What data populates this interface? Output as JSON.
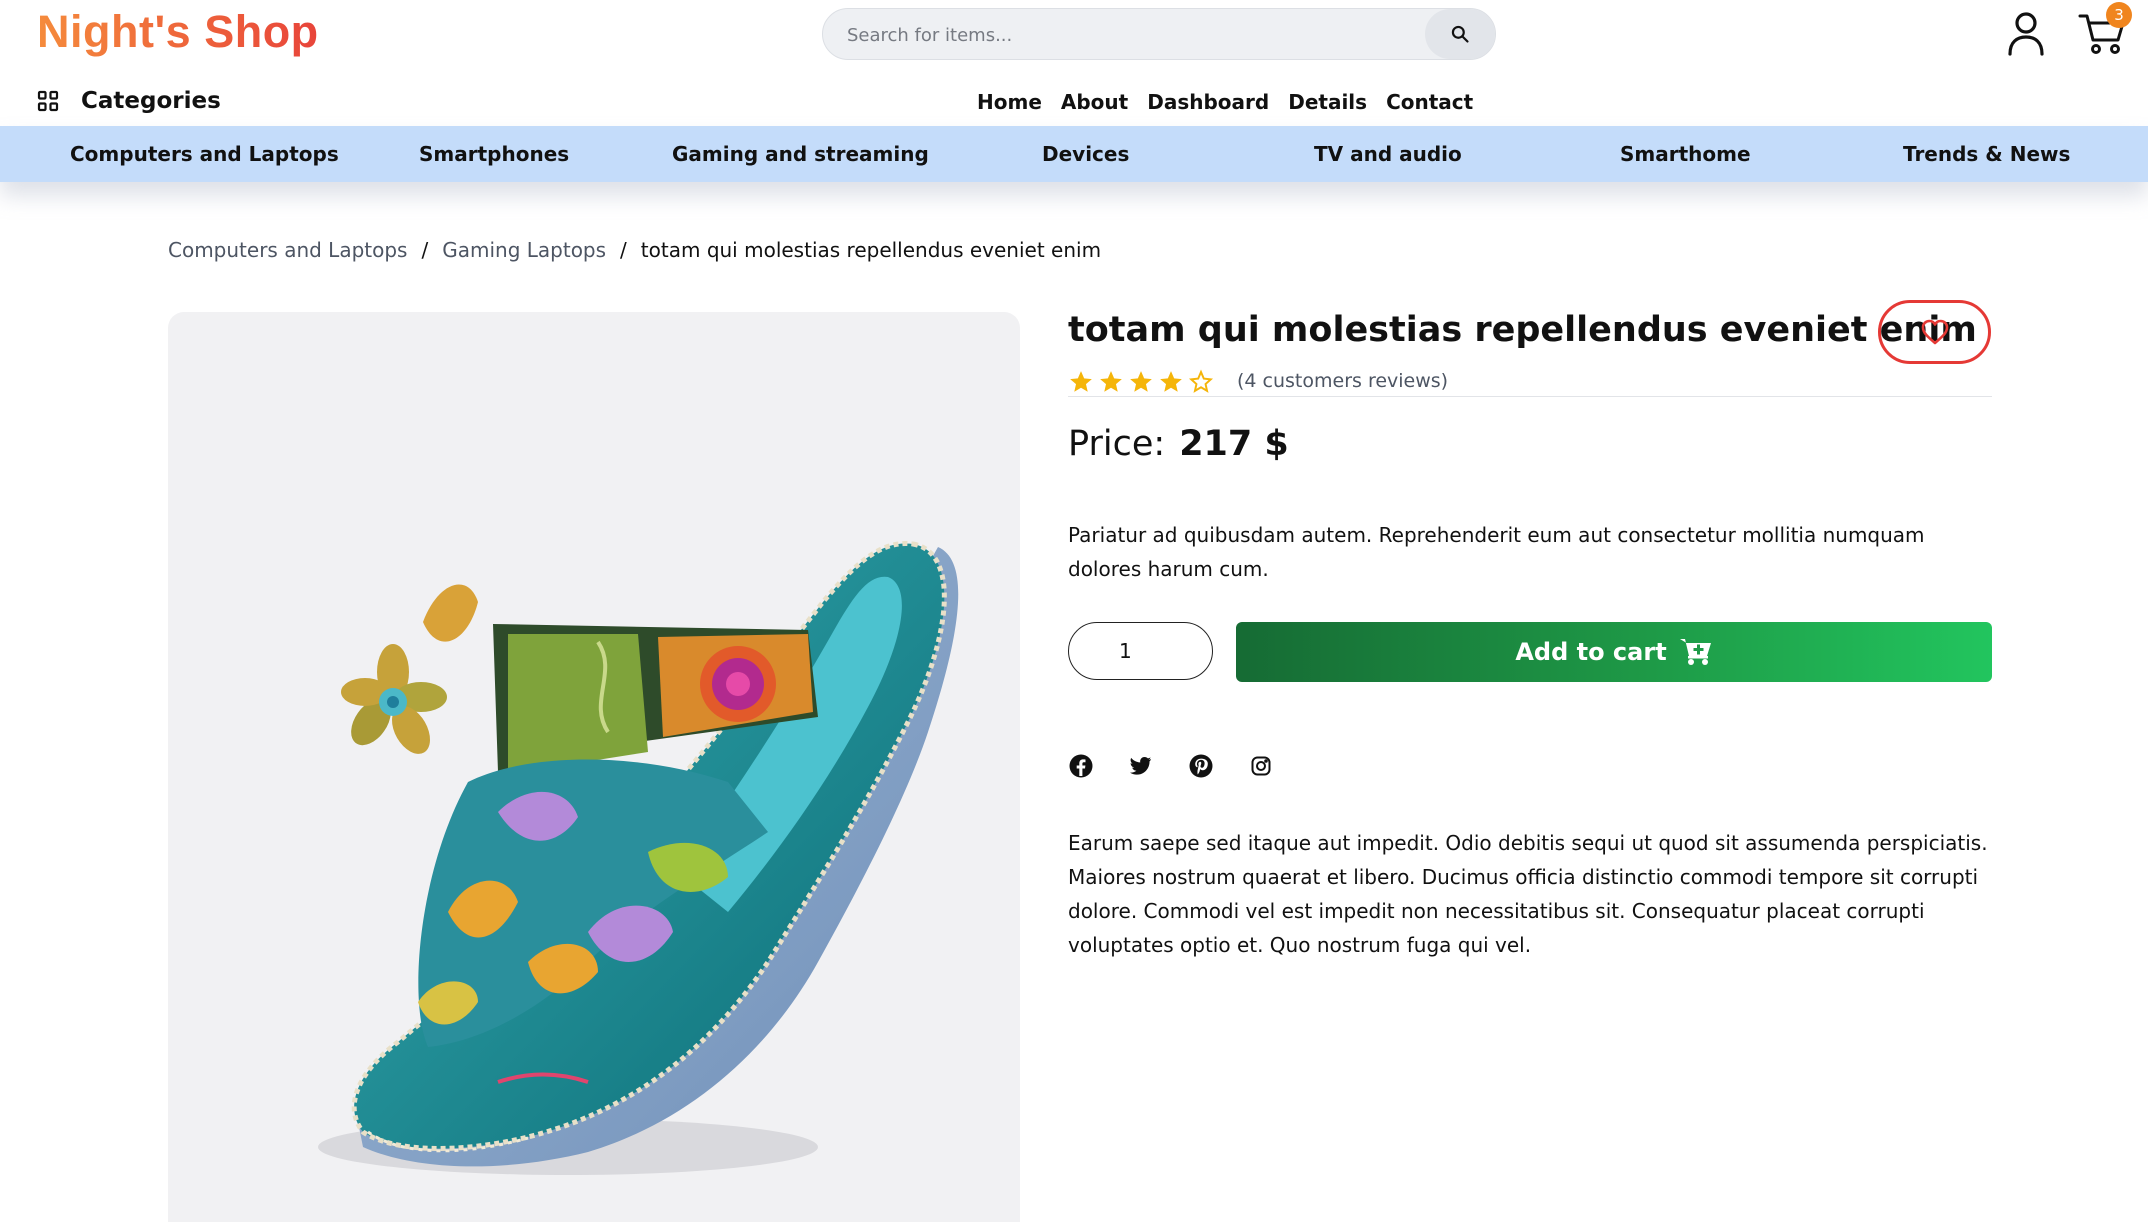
{
  "header": {
    "logo": "Night's Shop",
    "search_placeholder": "Search for items...",
    "cart_count": "3",
    "categories_label": "Categories",
    "nav": [
      "Home",
      "About",
      "Dashboard",
      "Details",
      "Contact"
    ]
  },
  "category_bar": [
    "Computers and Laptops",
    "Smartphones",
    "Gaming and streaming",
    "Devices",
    "TV and audio",
    "Smarthome",
    "Trends & News"
  ],
  "breadcrumb": {
    "items": [
      "Computers and Laptops",
      "Gaming Laptops"
    ],
    "separator": "/",
    "current": "totam qui molestias repellendus eveniet enim"
  },
  "product": {
    "title": "totam qui molestias repellendus eveniet enim",
    "rating": 4,
    "rating_max": 5,
    "reviews": "(4 customers reviews)",
    "price_label": "Price:",
    "price_value": "217 $",
    "short_description": "Pariatur ad quibusdam autem. Reprehenderit eum aut consectetur mollitia numquam dolores harum cum.",
    "quantity": "1",
    "add_to_cart_label": "Add to cart",
    "long_description": "Earum saepe sed itaque aut impedit. Odio debitis sequi ut quod sit assumenda perspiciatis. Maiores nostrum quaerat et libero. Ducimus officia distinctio commodi tempore sit corrupti dolore. Commodi vel est impedit non necessitatibus sit. Consequatur placeat corrupti voluptates optio et. Quo nostrum fuga qui vel.",
    "image_icon": "sandal-product-image"
  },
  "social_icons": [
    "facebook-icon",
    "twitter-icon",
    "pinterest-icon",
    "instagram-icon"
  ],
  "colors": {
    "logo_gradient_start": "#f58b3c",
    "logo_gradient_end": "#e8443a",
    "category_bar": "#c4dcfa",
    "cart_badge": "#f0851e",
    "favorite_border": "#e53935",
    "star": "#f5b50a",
    "add_to_cart_start": "#166b34",
    "add_to_cart_end": "#22c55e"
  }
}
